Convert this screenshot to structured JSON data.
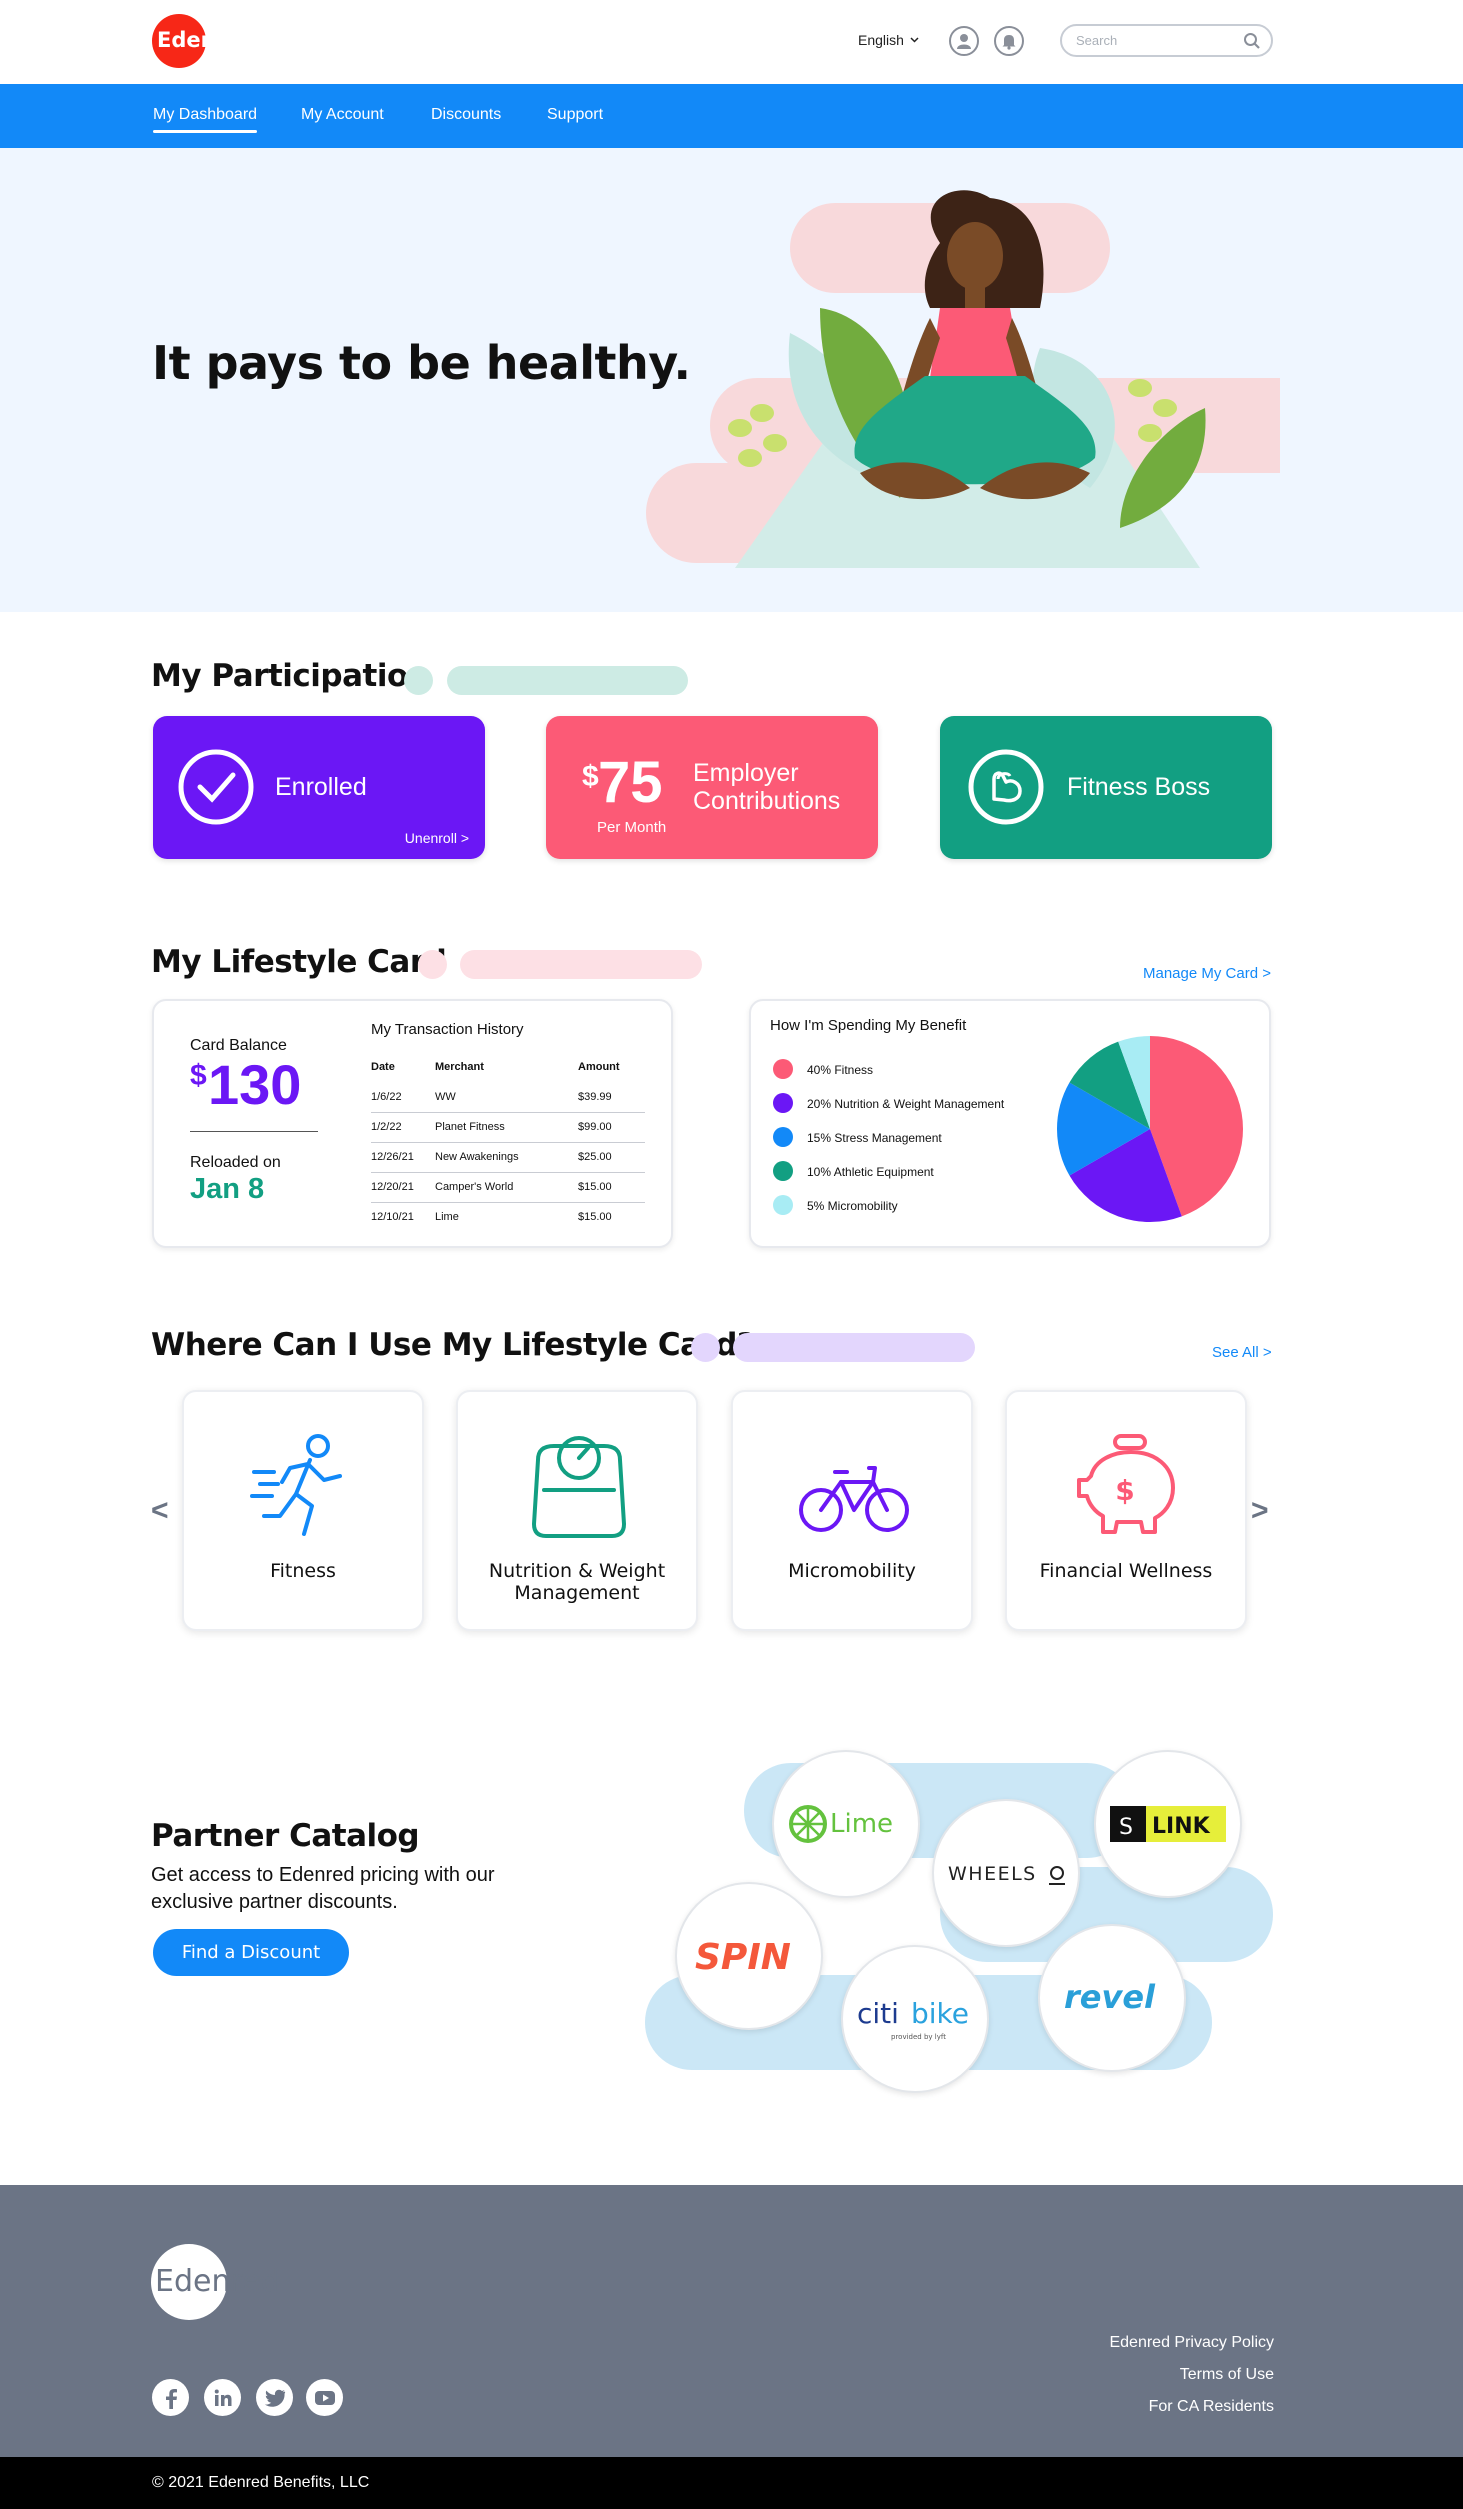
{
  "brand": {
    "logo_text": "Edenred",
    "red": "#f72717",
    "blue": "#1289f8",
    "purple": "#6b17f5",
    "pink": "#fc5a76",
    "teal": "#129f82"
  },
  "header": {
    "language": "English",
    "search_placeholder": "Search",
    "icons": [
      "user-icon",
      "bell-icon",
      "search-icon"
    ]
  },
  "nav": {
    "items": [
      "My Dashboard",
      "My Account",
      "Discounts",
      "Support"
    ],
    "active": "My Dashboard"
  },
  "hero": {
    "title": "It pays to be healthy."
  },
  "participation": {
    "title": "My Participation",
    "enrolled": {
      "label": "Enrolled",
      "link": "Unenroll >"
    },
    "contributions": {
      "currency": "$",
      "amount": "75",
      "sub": "Per Month",
      "label_line1": "Employer",
      "label_line2": "Contributions"
    },
    "badge": {
      "label": "Fitness Boss"
    }
  },
  "lifestyle": {
    "title": "My Lifestyle Card",
    "manage_link": "Manage My Card >",
    "balance": {
      "label": "Card Balance",
      "currency": "$",
      "amount": "130",
      "reloaded_label": "Reloaded on",
      "reloaded_date": "Jan 8"
    },
    "transactions": {
      "title": "My Transaction History",
      "headers": [
        "Date",
        "Merchant",
        "Amount"
      ],
      "rows": [
        [
          "1/6/22",
          "WW",
          "$39.99"
        ],
        [
          "1/2/22",
          "Planet Fitness",
          "$99.00"
        ],
        [
          "12/26/21",
          "New Awakenings",
          "$25.00"
        ],
        [
          "12/20/21",
          "Camper's World",
          "$15.00"
        ],
        [
          "12/10/21",
          "Lime",
          "$15.00"
        ]
      ]
    },
    "spending": {
      "title": "How I'm Spending My Benefit",
      "legend": [
        "40% Fitness",
        "20% Nutrition & Weight Management",
        "15% Stress Management",
        "10% Athletic Equipment",
        "5% Micromobility"
      ]
    }
  },
  "chart_data": {
    "type": "pie",
    "title": "How I'm Spending My Benefit",
    "categories": [
      "Fitness",
      "Nutrition & Weight Management",
      "Stress Management",
      "Athletic Equipment",
      "Micromobility"
    ],
    "values": [
      40,
      20,
      15,
      10,
      5
    ],
    "colors": [
      "#fc5a76",
      "#6b17f5",
      "#1289f8",
      "#129f82",
      "#a8ecf4"
    ]
  },
  "where": {
    "title": "Where Can I Use My Lifestyle Card?",
    "see_all": "See All >",
    "prev": "<",
    "next": ">",
    "tiles": [
      {
        "label": "Fitness",
        "icon": "runner-icon"
      },
      {
        "label": "Nutrition & Weight",
        "label2": "Management",
        "icon": "scale-icon"
      },
      {
        "label": "Micromobility",
        "icon": "bicycle-icon"
      },
      {
        "label": "Financial Wellness",
        "icon": "piggy-bank-icon"
      }
    ]
  },
  "partners": {
    "title": "Partner Catalog",
    "desc_line1": "Get access to Edenred pricing with our",
    "desc_line2": "exclusive partner discounts.",
    "button": "Find a Discount",
    "logos": {
      "lime": "Lime",
      "wheels": "WHEELS",
      "link": "LINK",
      "spin": "SPIN",
      "citi": "citi",
      "bike": "bike",
      "citi_sub": "provided by lyft",
      "revel": "revel"
    }
  },
  "footer": {
    "logo_text": "Edenred",
    "links": [
      "Edenred Privacy Policy",
      "Terms of Use",
      "For CA Residents"
    ],
    "social": [
      "facebook-icon",
      "linkedin-icon",
      "twitter-icon",
      "youtube-icon"
    ],
    "copyright": "© 2021 Edenred Benefits, LLC"
  }
}
